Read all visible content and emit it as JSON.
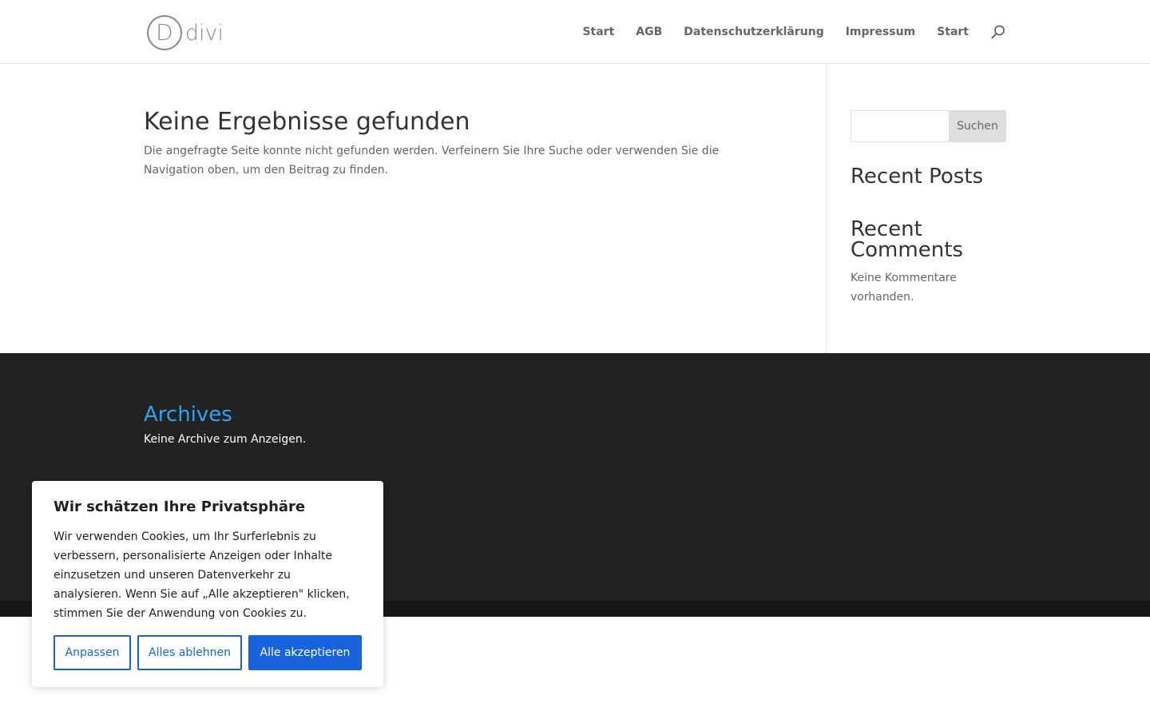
{
  "header": {
    "logo_letter": "D",
    "logo_text": "divi",
    "nav": [
      "Start",
      "AGB",
      "Datenschutzerklärung",
      "Impressum",
      "Start"
    ]
  },
  "main": {
    "title": "Keine Ergebnisse gefunden",
    "text": "Die angefragte Seite konnte nicht gefunden werden. Verfeinern Sie Ihre Suche oder verwenden Sie die Navigation oben, um den Beitrag zu finden."
  },
  "sidebar": {
    "search_button": "Suchen",
    "recent_posts_title": "Recent Posts",
    "recent_comments_title": "Recent Comments",
    "recent_comments_text": "Keine Kommentare vorhanden."
  },
  "footer": {
    "archives_title": "Archives",
    "archives_text": "Keine Archive zum Anzeigen."
  },
  "cookie": {
    "title": "Wir schätzen Ihre Privatsphäre",
    "text": "Wir verwenden Cookies, um Ihr Surferlebnis zu verbessern, personalisierte Anzeigen oder Inhalte einzusetzen und unseren Datenverkehr zu analysieren. Wenn Sie auf „Alle akzeptieren\" klicken, stimmen Sie der Anwendung von Cookies zu.",
    "customize": "Anpassen",
    "reject": "Alles ablehnen",
    "accept": "Alle akzeptieren"
  },
  "colors": {
    "accent": "#2ea3f2",
    "cookie_primary": "#1863dc",
    "footer_bg": "#222222"
  },
  "icons": {
    "search": "search-icon"
  }
}
